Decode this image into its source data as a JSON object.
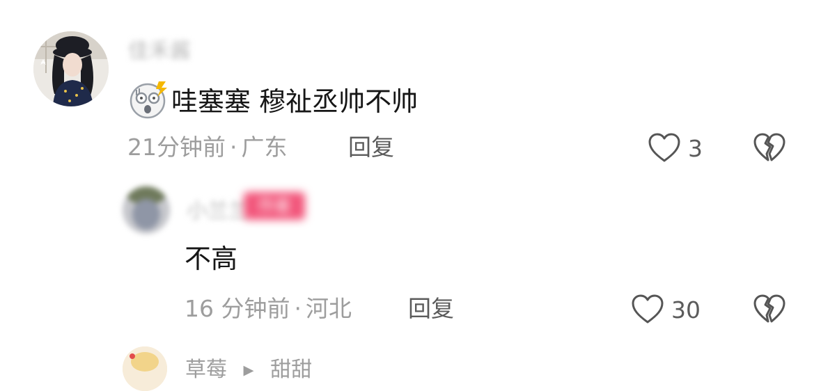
{
  "comments": [
    {
      "author": "佳禾酱",
      "emoji_icon": "shocked-face-emoji",
      "text": "哇塞塞 穆祉丞帅不帅",
      "time": "21分钟前",
      "location": "广东",
      "reply_label": "回复",
      "likes": "3"
    },
    {
      "author": "小兰兰",
      "badge": "作者",
      "text": "不高",
      "time": "16 分钟前",
      "location": "河北",
      "reply_label": "回复",
      "likes": "30"
    },
    {
      "author": "草莓",
      "reply_to": "甜甜"
    }
  ],
  "separator": "·",
  "colors": {
    "meta_gray": "#9d9d9d",
    "action_gray": "#5b5b5b",
    "author_badge": "#f2557a"
  }
}
